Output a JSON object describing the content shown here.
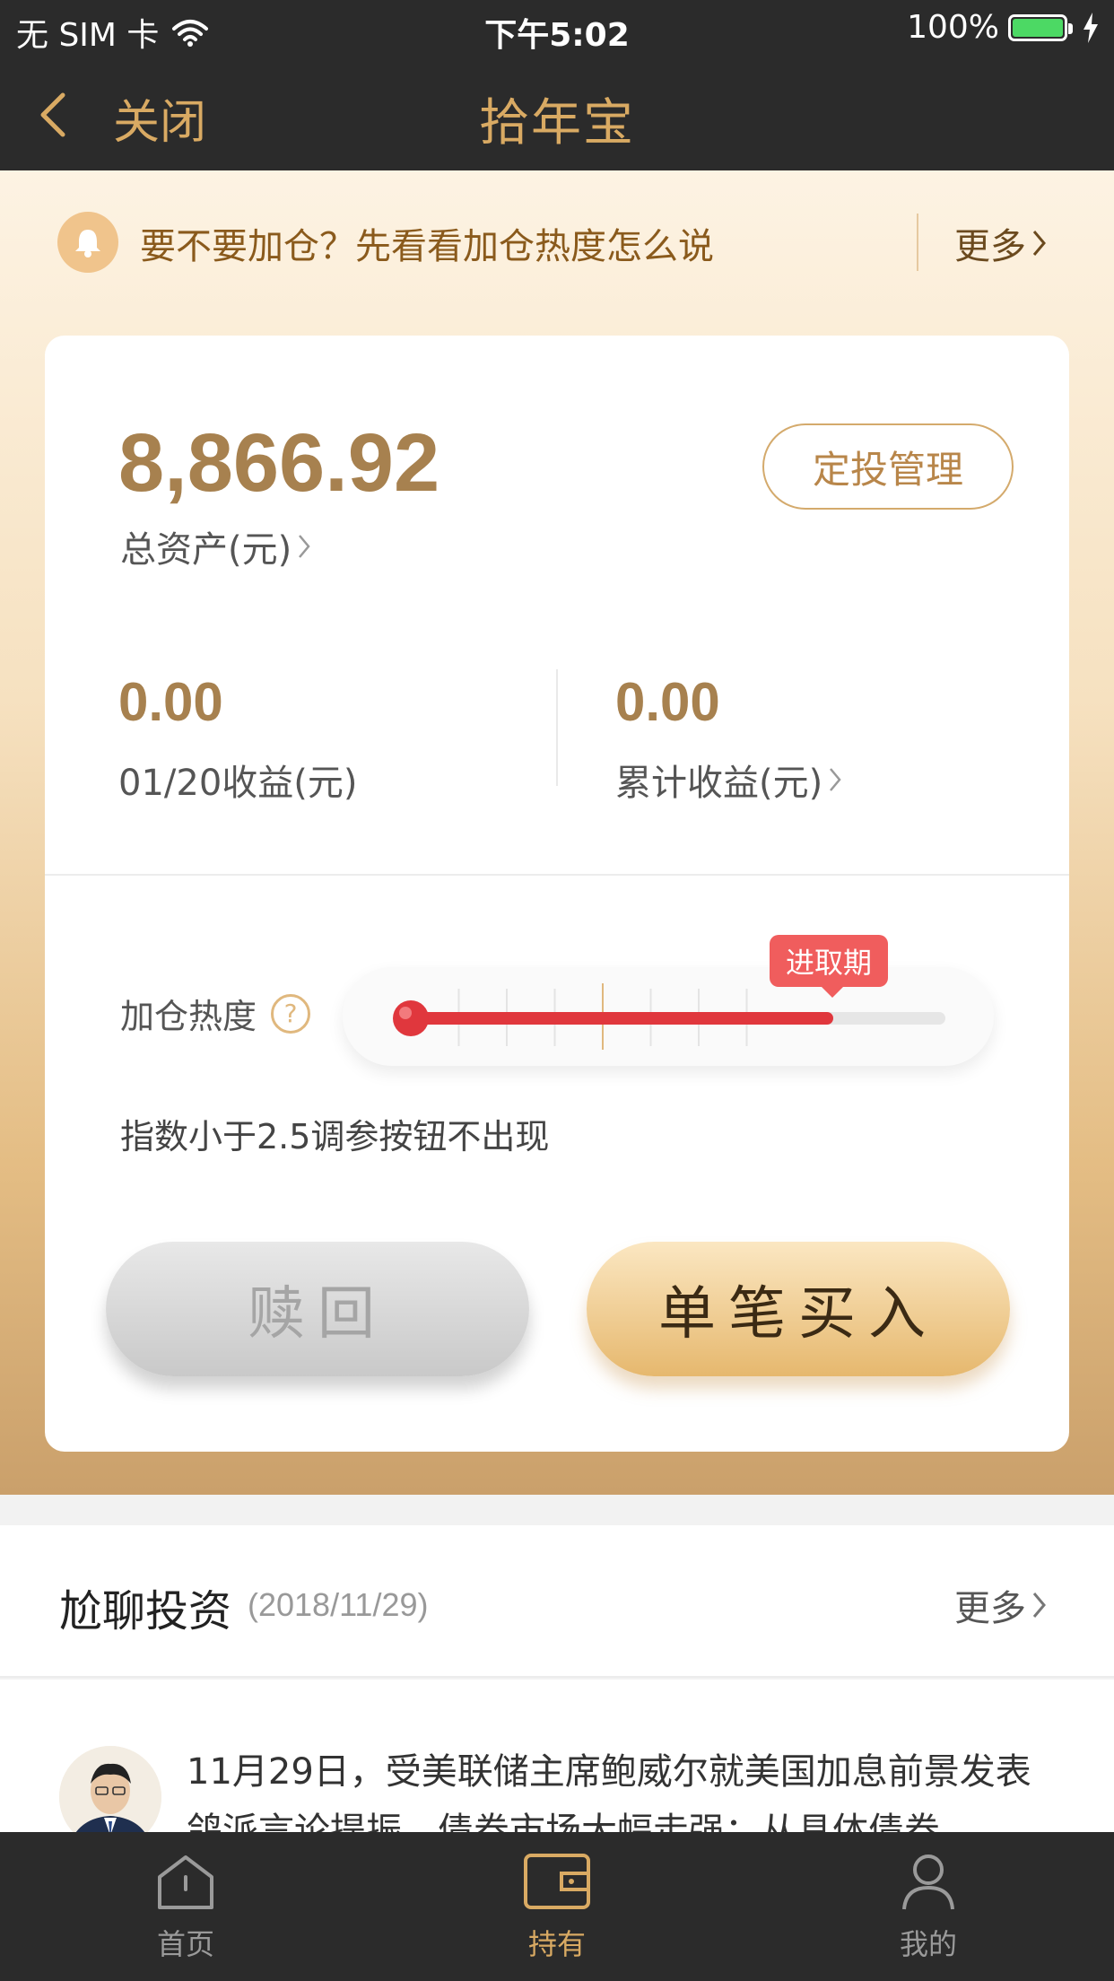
{
  "status_bar": {
    "carrier": "无 SIM 卡",
    "time": "下午5:02",
    "battery": "100%"
  },
  "nav": {
    "close_label": "关闭",
    "title": "拾年宝"
  },
  "notice": {
    "text": "要不要加仓？先看看加仓热度怎么说",
    "more_label": "更多"
  },
  "assets": {
    "total_amount": "8,866.92",
    "total_label": "总资产(元)",
    "plan_button": "定投管理",
    "daily_value": "0.00",
    "daily_label": "01/20收益(元)",
    "cumulative_value": "0.00",
    "cumulative_label": "累计收益(元)"
  },
  "heat": {
    "label": "加仓热度",
    "help_icon_text": "?",
    "badge": "进取期",
    "level_fraction": 0.79,
    "hint": "指数小于2.5调参按钮不出现"
  },
  "actions": {
    "redeem_label": "赎回",
    "buy_label": "单笔买入"
  },
  "section": {
    "title": "尬聊投资",
    "date": "(2018/11/29)",
    "more_label": "更多"
  },
  "article": {
    "text": "11月29日，受美联储主席鲍威尔就美国加息前景发表鸽派言论提振，债券市场大幅走强；从具体债券"
  },
  "tabs": [
    {
      "label": "首页",
      "icon": "home-icon",
      "active": false
    },
    {
      "label": "持有",
      "icon": "wallet-icon",
      "active": true
    },
    {
      "label": "我的",
      "icon": "person-icon",
      "active": false
    }
  ],
  "colors": {
    "accent_gold": "#d9aa63",
    "heat_red": "#e0373d",
    "badge_red": "#f05d5d",
    "bar_dark": "#2b2b2b"
  }
}
